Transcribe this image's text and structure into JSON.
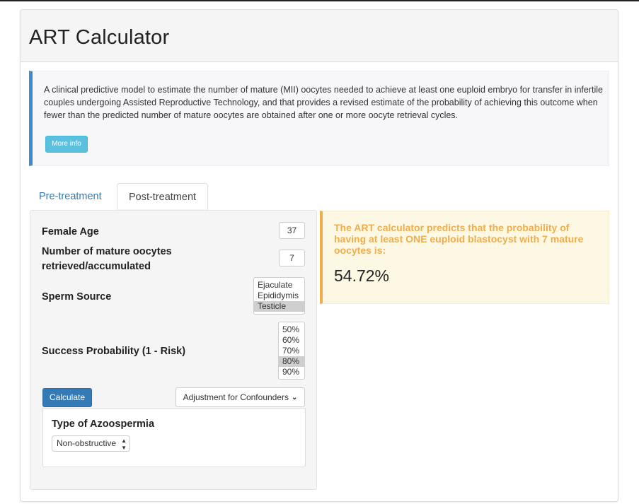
{
  "header": {
    "title": "ART Calculator"
  },
  "info": {
    "text": "A clinical predictive model to estimate the number of mature (MII) oocytes needed to achieve at least one euploid embryo for transfer in infertile couples undergoing Assisted Reproductive Technology, and that provides a revised estimate of the probability of achieving this outcome when fewer than the predicted number of mature oocytes are obtained after one or more oocyte retrieval cycles.",
    "more_label": "More info"
  },
  "tabs": [
    {
      "label": "Pre-treatment",
      "active": false
    },
    {
      "label": "Post-treatment",
      "active": true
    }
  ],
  "form": {
    "female_age": {
      "label": "Female Age",
      "value": "37"
    },
    "mature_oocytes": {
      "label_line1": "Number of mature oocytes",
      "label_line2": "retrieved/accumulated",
      "value": "7"
    },
    "sperm_source": {
      "label": "Sperm Source",
      "options": [
        "Ejaculate",
        "Epididymis",
        "Testicle"
      ],
      "selected": "Testicle"
    },
    "success_probability": {
      "label": "Success Probability (1 - Risk)",
      "options": [
        "50%",
        "60%",
        "70%",
        "80%",
        "90%"
      ],
      "selected": "80%"
    },
    "calculate_label": "Calculate",
    "adjustment_label": "Adjustment for Confounders",
    "confounders": {
      "title": "Type of Azoospermia",
      "selected": "Non-obstructive"
    }
  },
  "result": {
    "text": "The ART calculator predicts that the probability of having at least ONE euploid blastocyst with 7 mature oocytes is:",
    "value": "54.72%"
  },
  "colors": {
    "primary": "#337ab7",
    "info_button": "#5bc0de",
    "warning_text": "#f0ad4e",
    "warning_bg": "#fcf8e3"
  }
}
